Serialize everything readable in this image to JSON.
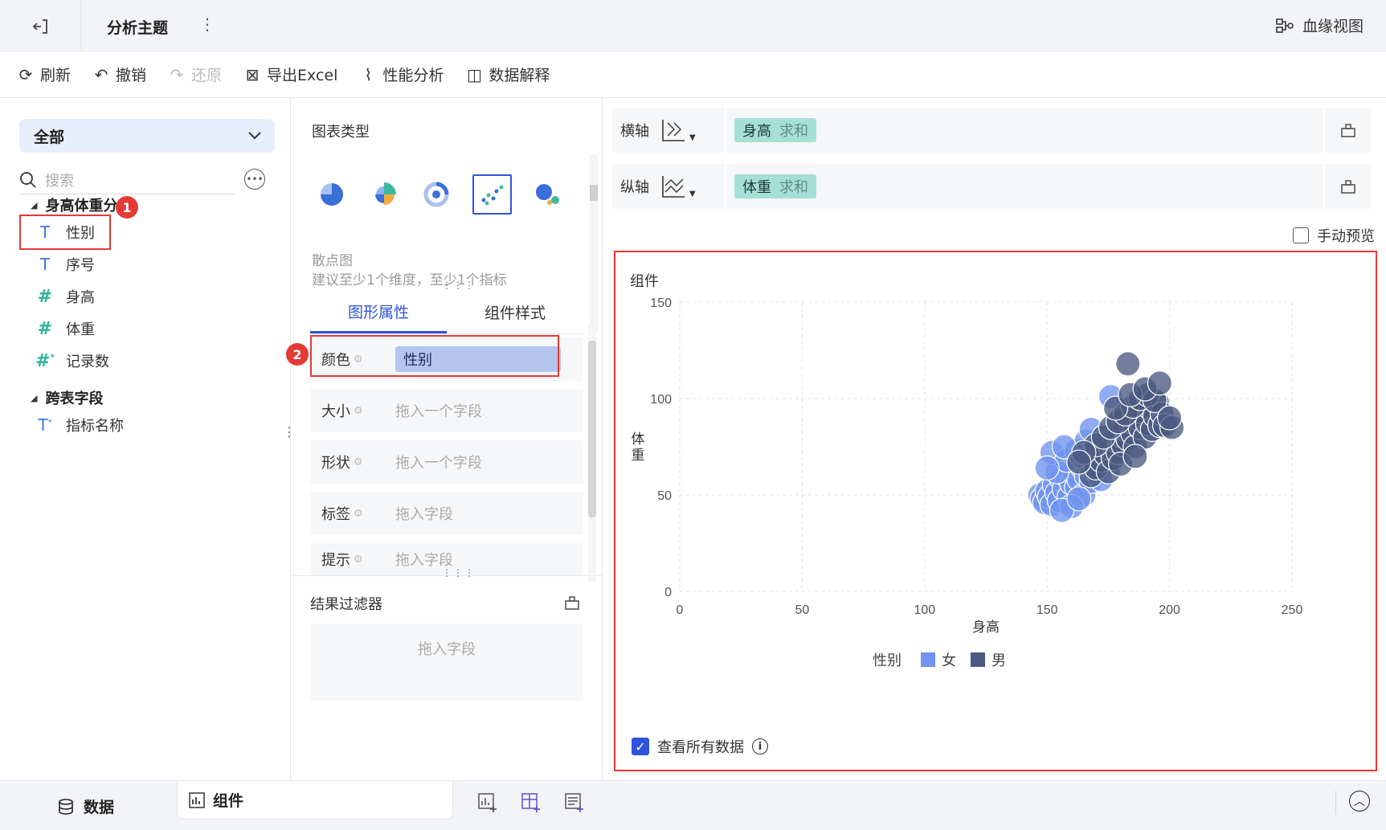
{
  "topbar": {
    "title": "分析主题",
    "more": "⋮",
    "lineage_label": "血缘视图"
  },
  "toolbar": {
    "items": [
      {
        "label": "刷新",
        "icon": "refresh-icon",
        "glyph": "⟳",
        "enabled": true
      },
      {
        "label": "撤销",
        "icon": "undo-icon",
        "glyph": "↶",
        "enabled": true
      },
      {
        "label": "还原",
        "icon": "redo-icon",
        "glyph": "↷",
        "enabled": false
      },
      {
        "label": "导出Excel",
        "icon": "excel-icon",
        "glyph": "⊠",
        "enabled": true
      },
      {
        "label": "性能分析",
        "icon": "performance-icon",
        "glyph": "⌇",
        "enabled": true
      },
      {
        "label": "数据解释",
        "icon": "explain-icon",
        "glyph": "◫",
        "enabled": true
      }
    ]
  },
  "left": {
    "scope_select": "全部",
    "search_placeholder": "搜索",
    "groups": [
      {
        "title": "身高体重分布",
        "fields": [
          {
            "label": "性别",
            "type": "dimension"
          },
          {
            "label": "序号",
            "type": "dimension"
          },
          {
            "label": "身高",
            "type": "measure"
          },
          {
            "label": "体重",
            "type": "measure"
          },
          {
            "label": "记录数",
            "type": "measure-calc"
          }
        ]
      },
      {
        "title": "跨表字段",
        "fields": [
          {
            "label": "指标名称",
            "type": "dimension-calc"
          }
        ]
      }
    ],
    "badge1": "1"
  },
  "middle": {
    "chart_type_title": "图表类型",
    "chart_hint_name": "散点图",
    "chart_hint_desc": "建议至少1个维度，至少1个指标",
    "tabs": [
      "图形属性",
      "组件样式"
    ],
    "active_tab": 0,
    "badge2": "2",
    "props": [
      {
        "label": "颜色",
        "value": "性别",
        "placeholder": ""
      },
      {
        "label": "大小",
        "value": "",
        "placeholder": "拖入一个字段"
      },
      {
        "label": "形状",
        "value": "",
        "placeholder": "拖入一个字段"
      },
      {
        "label": "标签",
        "value": "",
        "placeholder": "拖入字段"
      },
      {
        "label": "提示",
        "value": "",
        "placeholder": "拖入字段"
      }
    ],
    "filter_title": "结果过滤器",
    "filter_placeholder": "拖入字段"
  },
  "right": {
    "x_axis": {
      "label": "横轴",
      "field": "身高",
      "agg": "求和"
    },
    "y_axis": {
      "label": "纵轴",
      "field": "体重",
      "agg": "求和"
    },
    "manual_preview": "手动预览",
    "widget_title": "组件",
    "view_all": "查看所有数据",
    "legend_title": "性别"
  },
  "chart_data": {
    "type": "scatter",
    "xlabel": "身高",
    "ylabel": "体重",
    "xlim": [
      0,
      250
    ],
    "ylim": [
      0,
      150
    ],
    "xticks": [
      0,
      50,
      100,
      150,
      200,
      250
    ],
    "yticks": [
      0,
      50,
      100,
      150
    ],
    "grid": true,
    "legend": "bottom",
    "series": [
      {
        "name": "女",
        "color": "#6f93ee",
        "points": [
          [
            147,
            50
          ],
          [
            148,
            48
          ],
          [
            149,
            46
          ],
          [
            150,
            52
          ],
          [
            151,
            49
          ],
          [
            152,
            45
          ],
          [
            153,
            55
          ],
          [
            154,
            51
          ],
          [
            155,
            47
          ],
          [
            156,
            58
          ],
          [
            157,
            53
          ],
          [
            158,
            60
          ],
          [
            159,
            49
          ],
          [
            160,
            56
          ],
          [
            161,
            62
          ],
          [
            162,
            54
          ],
          [
            163,
            58
          ],
          [
            164,
            65
          ],
          [
            165,
            50
          ],
          [
            166,
            60
          ],
          [
            167,
            66
          ],
          [
            168,
            57
          ],
          [
            169,
            63
          ],
          [
            170,
            70
          ],
          [
            171,
            61
          ],
          [
            154,
            62
          ],
          [
            152,
            72
          ],
          [
            158,
            68
          ],
          [
            162,
            73
          ],
          [
            166,
            78
          ],
          [
            173,
            67
          ],
          [
            160,
            44
          ],
          [
            156,
            42
          ],
          [
            150,
            64
          ],
          [
            164,
            70
          ],
          [
            168,
            84
          ],
          [
            176,
            101
          ],
          [
            170,
            74
          ],
          [
            157,
            75
          ],
          [
            163,
            48
          ],
          [
            172,
            58
          ]
        ]
      },
      {
        "name": "男",
        "color": "#4a5a80",
        "points": [
          [
            168,
            60
          ],
          [
            170,
            64
          ],
          [
            172,
            68
          ],
          [
            174,
            71
          ],
          [
            175,
            62
          ],
          [
            176,
            74
          ],
          [
            177,
            69
          ],
          [
            178,
            78
          ],
          [
            179,
            72
          ],
          [
            180,
            81
          ],
          [
            181,
            76
          ],
          [
            182,
            84
          ],
          [
            183,
            79
          ],
          [
            184,
            88
          ],
          [
            185,
            82
          ],
          [
            186,
            75
          ],
          [
            187,
            90
          ],
          [
            188,
            85
          ],
          [
            189,
            93
          ],
          [
            190,
            80
          ],
          [
            191,
            87
          ],
          [
            192,
            95
          ],
          [
            193,
            84
          ],
          [
            194,
            91
          ],
          [
            195,
            98
          ],
          [
            196,
            86
          ],
          [
            197,
            92
          ],
          [
            170,
            76
          ],
          [
            173,
            80
          ],
          [
            176,
            85
          ],
          [
            179,
            88
          ],
          [
            182,
            92
          ],
          [
            185,
            96
          ],
          [
            188,
            100
          ],
          [
            191,
            102
          ],
          [
            194,
            99
          ],
          [
            198,
            86
          ],
          [
            201,
            85
          ],
          [
            200,
            90
          ],
          [
            178,
            95
          ],
          [
            184,
            102
          ],
          [
            190,
            105
          ],
          [
            183,
            118
          ],
          [
            196,
            108
          ],
          [
            180,
            66
          ],
          [
            186,
            70
          ],
          [
            165,
            72
          ],
          [
            163,
            67
          ]
        ]
      }
    ]
  }
}
